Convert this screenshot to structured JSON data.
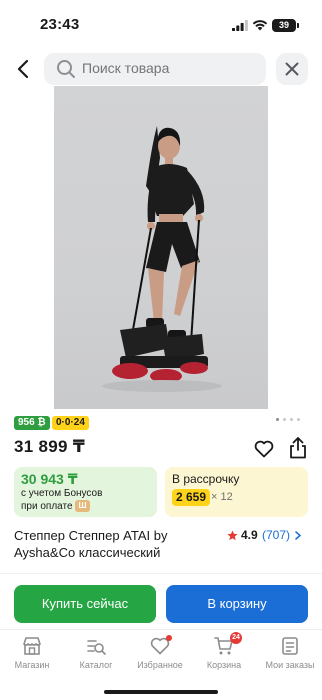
{
  "status_bar": {
    "time": "23:43",
    "battery": "39"
  },
  "search": {
    "placeholder": "Поиск товара"
  },
  "product": {
    "image_alt": "Степпер с эспандерами",
    "bonus_badge": "956 ₿",
    "installment_badge": "0·0·24",
    "price": "31 899 ₸",
    "title": "Степпер Степпер ATAI by Aysha&Co классический",
    "rating": {
      "value": "4.9",
      "count": "(707)"
    },
    "bonus": {
      "value": "30 943 ₸",
      "line1": "с учетом Бонусов",
      "line2": "при оплате",
      "chip": "Ш"
    },
    "installment": {
      "title": "В рассрочку",
      "amount": "2 659",
      "multiplier": "× 12"
    }
  },
  "actions": {
    "buy_now": "Купить сейчас",
    "add_to_cart": "В корзину"
  },
  "nav": {
    "items": [
      {
        "label": "Магазин",
        "icon": "store-icon"
      },
      {
        "label": "Каталог",
        "icon": "catalog-icon"
      },
      {
        "label": "Избранное",
        "icon": "heart-icon"
      },
      {
        "label": "Корзина",
        "icon": "cart-icon"
      },
      {
        "label": "Мои заказы",
        "icon": "orders-icon"
      }
    ],
    "cart_count": "24"
  },
  "colors": {
    "green": "#26a545",
    "blue": "#1a6ed6",
    "yellow": "#ffd31a",
    "red": "#e53935"
  }
}
